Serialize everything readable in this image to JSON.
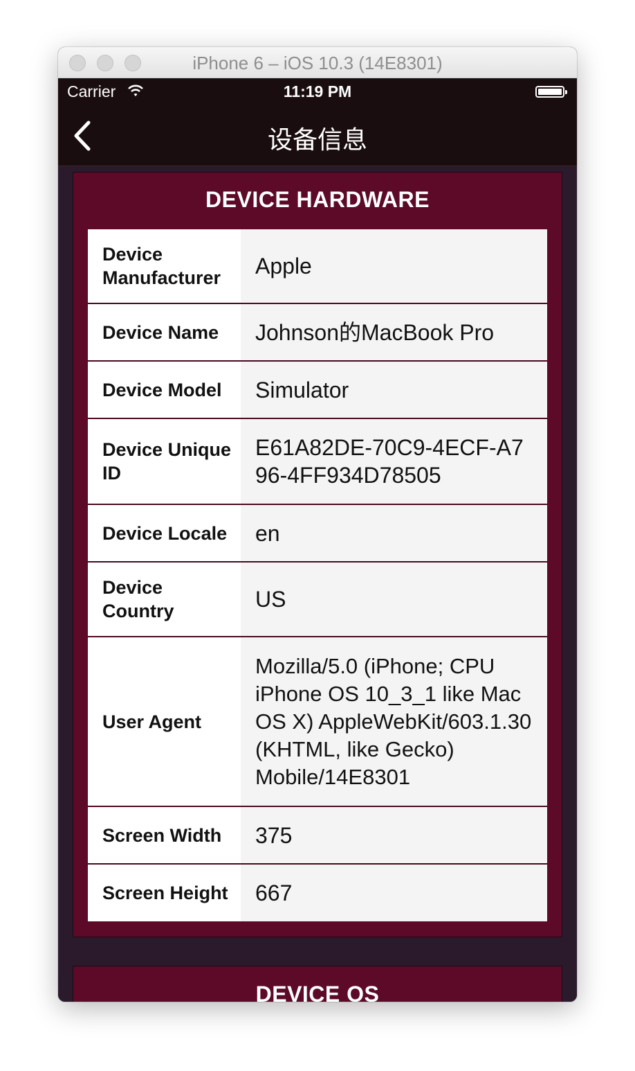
{
  "window": {
    "title": "iPhone 6 – iOS 10.3 (14E8301)"
  },
  "status_bar": {
    "carrier": "Carrier",
    "time": "11:19 PM"
  },
  "nav": {
    "title": "设备信息",
    "back_icon": "chevron-left-icon"
  },
  "hardware": {
    "title": "DEVICE HARDWARE",
    "rows": [
      {
        "label": "Device Manufacturer",
        "value": "Apple"
      },
      {
        "label": "Device Name",
        "value": "Johnson的MacBook Pro"
      },
      {
        "label": "Device Model",
        "value": "Simulator"
      },
      {
        "label": "Device Unique ID",
        "value": "E61A82DE-70C9-4ECF-A796-4FF934D78505"
      },
      {
        "label": "Device Locale",
        "value": "en"
      },
      {
        "label": "Device Country",
        "value": "US"
      },
      {
        "label": "User Agent",
        "value": "Mozilla/5.0 (iPhone; CPU iPhone OS 10_3_1 like Mac OS X) AppleWebKit/603.1.30 (KHTML, like Gecko) Mobile/14E8301"
      },
      {
        "label": "Screen Width",
        "value": "375"
      },
      {
        "label": "Screen Height",
        "value": "667"
      }
    ]
  },
  "os": {
    "title": "DEVICE OS"
  },
  "colors": {
    "card_background": "#5c0a28",
    "page_background": "#2a1a2c",
    "bar_background": "#1a0d0f"
  }
}
